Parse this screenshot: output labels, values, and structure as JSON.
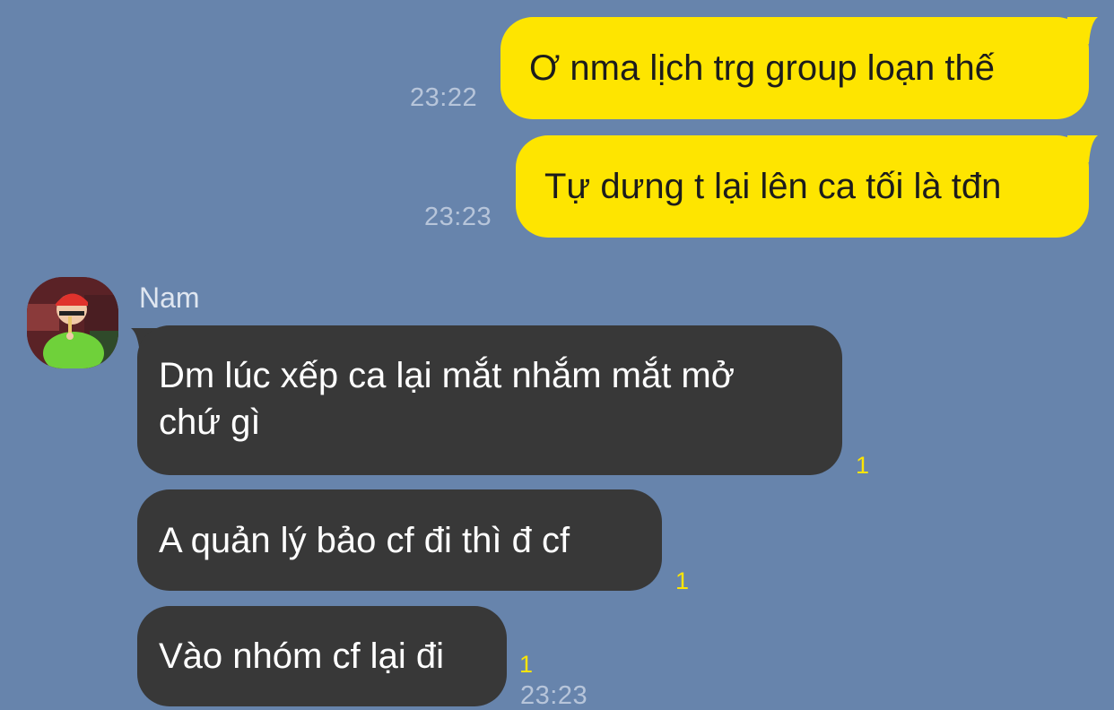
{
  "colors": {
    "background": "#6784ac",
    "outgoing_bubble": "#fee500",
    "incoming_bubble": "#383838",
    "timestamp": "#b7c5da",
    "unread": "#fee500"
  },
  "messages_out": [
    {
      "text": "Ơ nma lịch trg group loạn thế",
      "time": "23:22"
    },
    {
      "text": "Tự dưng t lại lên ca tối là tđn",
      "time": "23:23"
    }
  ],
  "contact": {
    "name": "Nam",
    "avatar_icon": "profile-photo"
  },
  "messages_in": [
    {
      "line1": "Dm lúc xếp ca lại mắt nhắm mắt mở",
      "line2": "chứ gì",
      "unread": "1"
    },
    {
      "text": "A quản lý bảo cf đi thì đ cf",
      "unread": "1"
    },
    {
      "text": "Vào nhóm cf lại đi",
      "unread": "1",
      "time": "23:23"
    }
  ]
}
